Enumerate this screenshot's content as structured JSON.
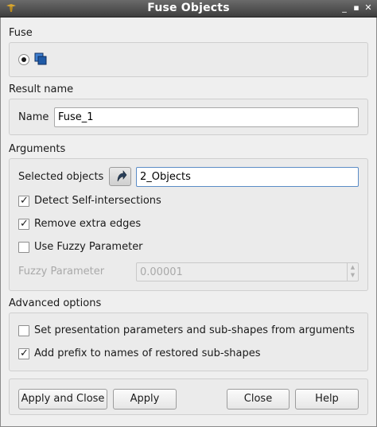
{
  "window": {
    "title": "Fuse Objects",
    "controls": {
      "minimize": "_",
      "maximize": "▪",
      "close": "✕"
    }
  },
  "fuse": {
    "section_label": "Fuse",
    "option_selected": true,
    "icon": "fuse-shapes-icon"
  },
  "result": {
    "section_label": "Result name",
    "name_label": "Name",
    "name_value": "Fuse_1"
  },
  "arguments": {
    "section_label": "Arguments",
    "selected_objects_label": "Selected objects",
    "selected_objects_value": "2_Objects",
    "select_icon": "select-arrow-icon",
    "detect_self_intersections": {
      "label": "Detect Self-intersections",
      "checked": true
    },
    "remove_extra_edges": {
      "label": "Remove extra edges",
      "checked": true
    },
    "use_fuzzy_parameter": {
      "label": "Use Fuzzy Parameter",
      "checked": false
    },
    "fuzzy_parameter_label": "Fuzzy Parameter",
    "fuzzy_parameter_value": "0.00001"
  },
  "advanced": {
    "section_label": "Advanced options",
    "set_presentation": {
      "label": "Set presentation parameters and sub-shapes from arguments",
      "checked": false
    },
    "add_prefix": {
      "label": "Add prefix to names of restored sub-shapes",
      "checked": true
    }
  },
  "buttons": {
    "apply_and_close": "Apply and Close",
    "apply": "Apply",
    "close": "Close",
    "help": "Help"
  },
  "colors": {
    "titlebar": "#4a4a4a",
    "background": "#efefef",
    "focus_border": "#5b8cc6",
    "fuse_icon": "#1f5aa6"
  }
}
